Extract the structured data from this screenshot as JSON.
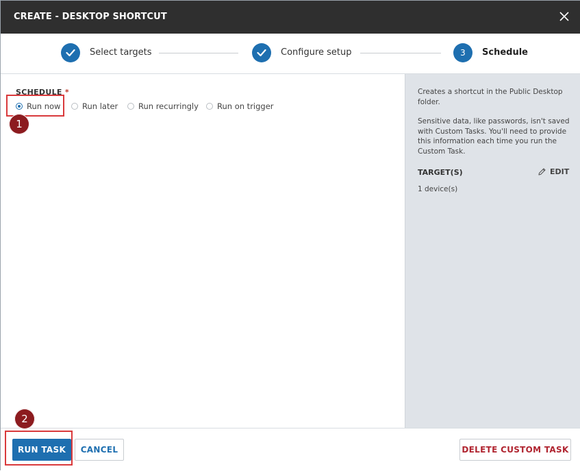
{
  "dialog": {
    "title": "CREATE - DESKTOP SHORTCUT",
    "close_icon": "close-icon"
  },
  "wizard": {
    "steps": [
      {
        "label": "Select targets",
        "state": "complete",
        "icon": "check-icon"
      },
      {
        "label": "Configure setup",
        "state": "complete",
        "icon": "check-icon"
      },
      {
        "label": "Schedule",
        "state": "current",
        "number": "3"
      }
    ]
  },
  "schedule": {
    "label": "SCHEDULE",
    "required_mark": "*",
    "options": [
      {
        "label": "Run now",
        "selected": true
      },
      {
        "label": "Run later",
        "selected": false
      },
      {
        "label": "Run recurringly",
        "selected": false
      },
      {
        "label": "Run on trigger",
        "selected": false
      }
    ]
  },
  "sidebar": {
    "description_1": "Creates a shortcut in the Public Desktop folder.",
    "description_2": "Sensitive data, like passwords, isn't saved with Custom Tasks. You'll need to provide this information each time you run the Custom Task.",
    "targets_heading": "TARGET(S)",
    "edit_label": "EDIT",
    "edit_icon": "pencil-icon",
    "targets_value": "1 device(s)"
  },
  "footer": {
    "run_label": "RUN TASK",
    "cancel_label": "CANCEL",
    "delete_label": "DELETE CUSTOM TASK"
  },
  "annotations": {
    "badge_1": "1",
    "badge_2": "2"
  },
  "colors": {
    "accent": "#1e6fb0",
    "titlebar": "#2f2f2f",
    "danger": "#b0242f",
    "sidebar_bg": "#dfe3e8",
    "highlight": "#d9393b",
    "badge": "#8c1b1f"
  }
}
